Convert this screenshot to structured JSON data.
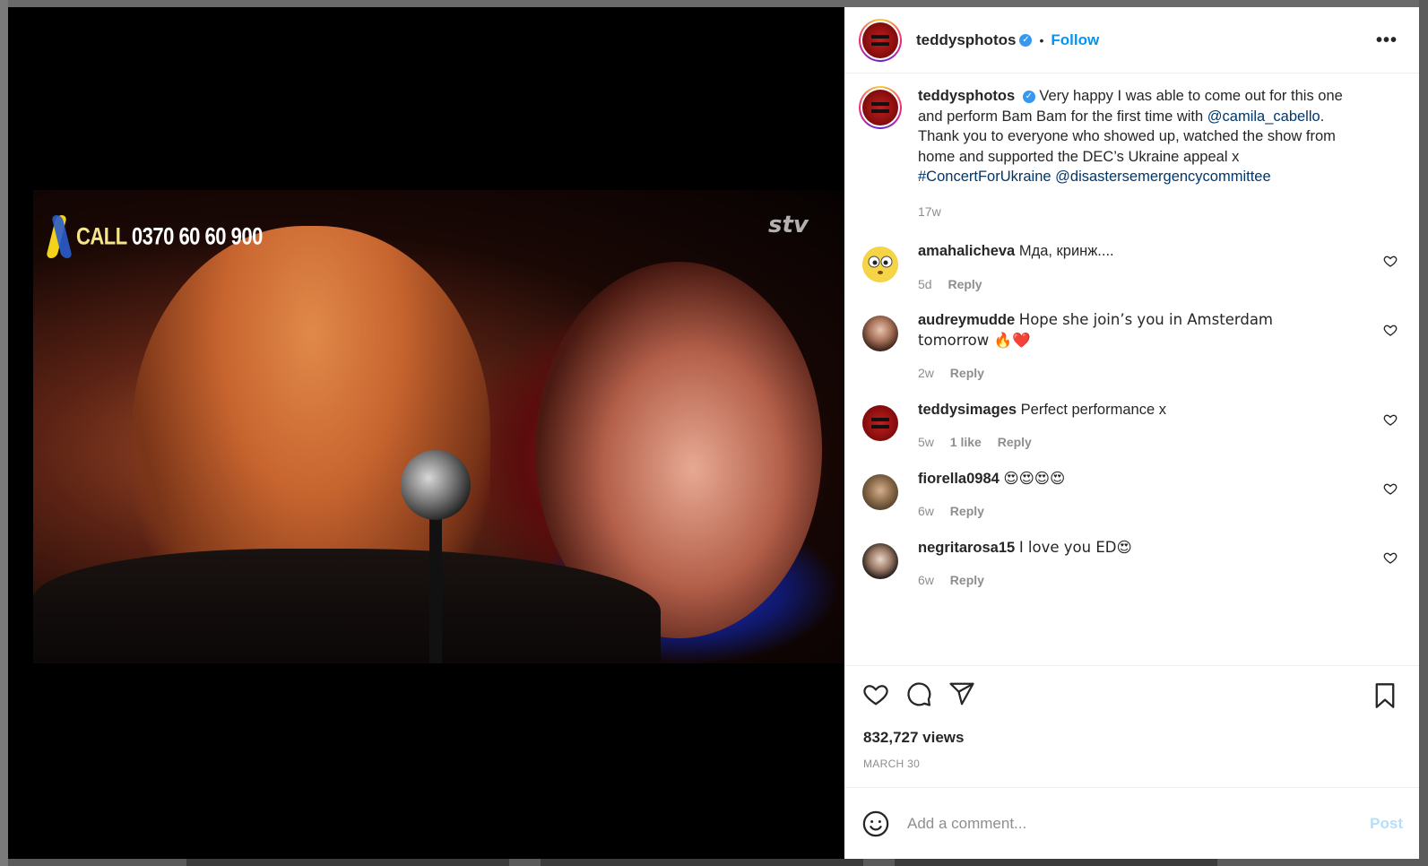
{
  "header": {
    "username": "teddysphotos",
    "separator": "•",
    "follow_label": "Follow",
    "more_label": "•••"
  },
  "video_overlay": {
    "call_label": "CALL",
    "call_number": "0370 60 60 900",
    "channel_logo": "stv"
  },
  "caption": {
    "username": "teddysphotos",
    "text_1": "Very happy I was able to come out for this one and perform Bam Bam for the first time with ",
    "mention_1": "@camila_cabello",
    "text_2": ". Thank you to everyone who showed up, watched the show from home and supported the DEC’s Ukraine appeal x ",
    "hashtag": "#ConcertForUkraine",
    "mention_2": "@disastersemergencycommittee",
    "time": "17w"
  },
  "comments": [
    {
      "username": "amahalicheva",
      "text": "Мда, кринж....",
      "time": "5d",
      "likes": "",
      "reply": "Reply",
      "avatar_icon": "surprised-face-icon"
    },
    {
      "username": "audreymudde",
      "text": "Hope she join’s you in Amsterdam tomorrow 🔥❤️",
      "time": "2w",
      "likes": "",
      "reply": "Reply",
      "avatar_icon": "user-photo-icon"
    },
    {
      "username": "teddysimages",
      "text": "Perfect performance x",
      "time": "5w",
      "likes": "1 like",
      "reply": "Reply",
      "avatar_icon": "equals-logo-icon"
    },
    {
      "username": "fiorella0984",
      "text": "😍😍😍😍",
      "time": "6w",
      "likes": "",
      "reply": "Reply",
      "avatar_icon": "user-photo-icon"
    },
    {
      "username": "negritarosa15",
      "text": "I love you ED😍",
      "time": "6w",
      "likes": "",
      "reply": "Reply",
      "avatar_icon": "user-photo-icon"
    }
  ],
  "actions": {
    "views": "832,727 views",
    "date": "MARCH 30"
  },
  "composer": {
    "placeholder": "Add a comment...",
    "post_label": "Post"
  },
  "colors": {
    "accent": "#0095f6",
    "link": "#00376b",
    "post_disabled": "#b2dffc",
    "verified": "#3897f0"
  }
}
